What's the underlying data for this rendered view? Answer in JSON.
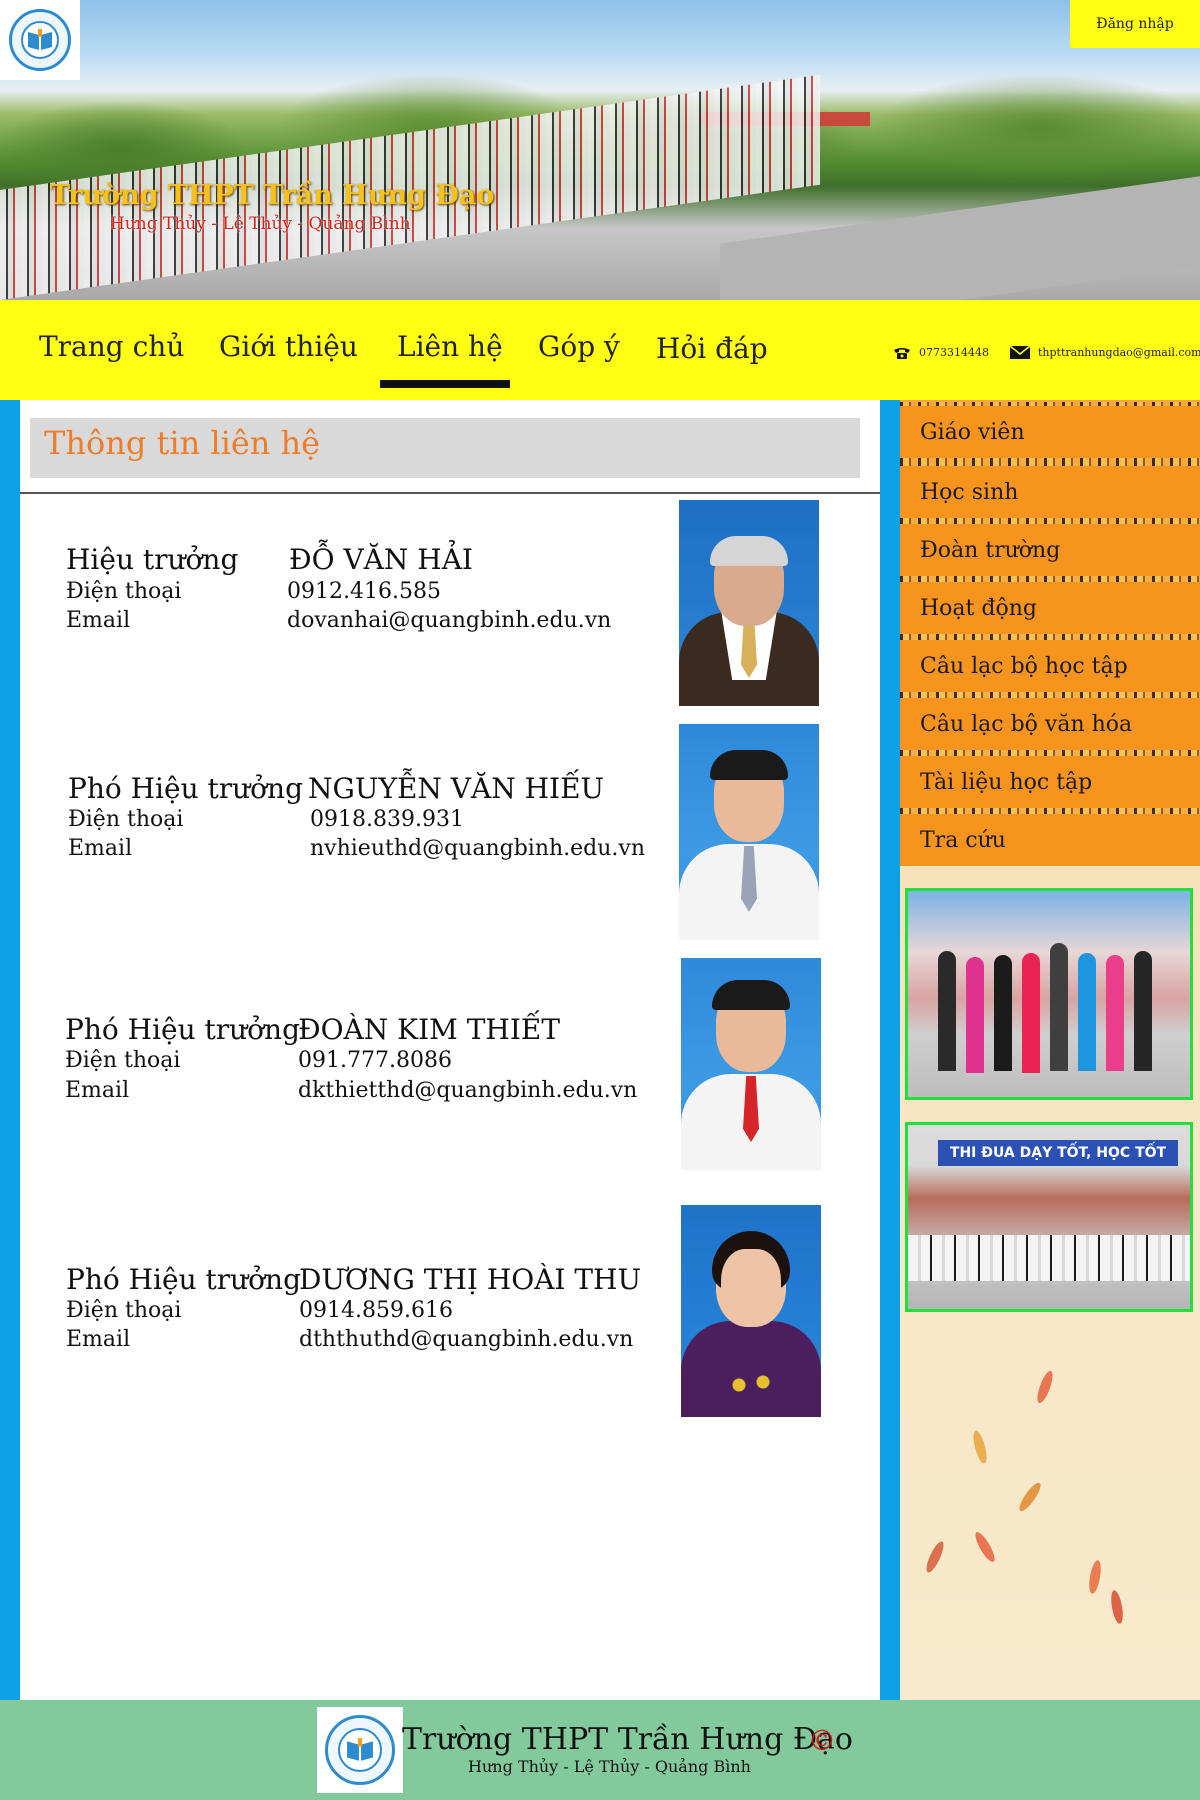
{
  "header": {
    "school_name": "Trường THPT Trần Hưng Đạo",
    "location": "Hưng Thủy - Lệ Thủy - Quảng Bình",
    "login_label": "Đăng nhập"
  },
  "nav": {
    "items": [
      {
        "label": "Trang chủ"
      },
      {
        "label": "Giới thiệu"
      },
      {
        "label": "Liên hệ",
        "active": true
      },
      {
        "label": "Góp ý"
      },
      {
        "label": "Hỏi đáp"
      }
    ],
    "phone": "0773314448",
    "email": "thpttranhungdao@gmail.com"
  },
  "main": {
    "section_title": "Thông tin liên hệ",
    "phone_label": "Điện thoại",
    "email_label": "Email",
    "contacts": [
      {
        "role": "Hiệu trưởng",
        "name": "ĐỖ VĂN HẢI",
        "phone": "0912.416.585",
        "email": "dovanhai@quangbinh.edu.vn"
      },
      {
        "role": "Phó Hiệu trưởng",
        "name": "NGUYỄN VĂN HIẾU",
        "phone": "0918.839.931",
        "email": "nvhieuthd@quangbinh.edu.vn"
      },
      {
        "role": "Phó Hiệu trưởng",
        "name": "ĐOÀN KIM THIẾT",
        "phone": "091.777.8086",
        "email": "dkthietthd@quangbinh.edu.vn"
      },
      {
        "role": "Phó Hiệu trưởng",
        "name": "DƯƠNG THỊ HOÀI THU",
        "phone": "0914.859.616",
        "email": "dththuthd@quangbinh.edu.vn"
      }
    ]
  },
  "sidebar": {
    "items": [
      {
        "label": "Giáo viên"
      },
      {
        "label": "Học sinh"
      },
      {
        "label": "Đoàn trường"
      },
      {
        "label": "Hoạt động"
      },
      {
        "label": "Câu lạc bộ học tập"
      },
      {
        "label": "Câu lạc bộ văn hóa"
      },
      {
        "label": "Tài liệu học tập"
      },
      {
        "label": "Tra cứu"
      }
    ],
    "photo2_banner": "THI ĐUA DẠY TỐT, HỌC TỐT"
  },
  "footer": {
    "title": "Trường THPT Trần Hưng Đạo",
    "copyright": "©",
    "subtitle": "Hưng Thủy - Lệ Thủy - Quảng Bình"
  },
  "colors": {
    "nav_bg": "#ffff14",
    "accent_blue": "#0da0e6",
    "title_orange": "#f07c2a",
    "sidebar_item": "#f7941d",
    "footer_bg": "#82c99b"
  }
}
